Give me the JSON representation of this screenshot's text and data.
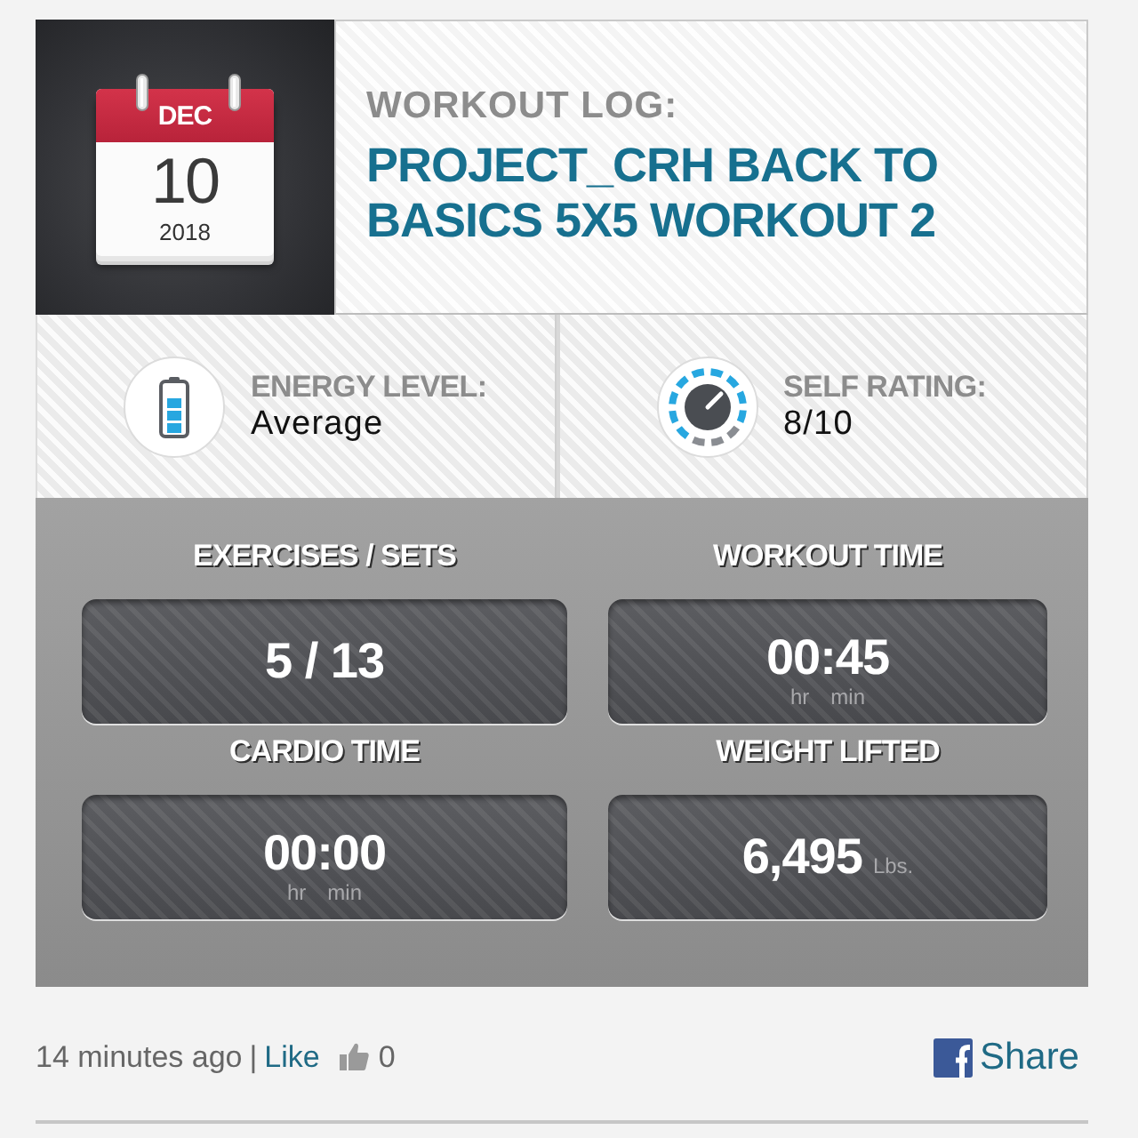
{
  "log": {
    "date": {
      "month": "DEC",
      "day": "10",
      "year": "2018"
    },
    "heading": "WORKOUT LOG:",
    "title": "PROJECT_CRH BACK TO BASICS 5X5 WORKOUT 2"
  },
  "ratings": [
    {
      "kind": "energy",
      "label": "ENERGY LEVEL:",
      "value": "Average"
    },
    {
      "kind": "rating",
      "label": "SELF RATING:",
      "value": "8/10"
    }
  ],
  "stats": [
    {
      "kind": "count",
      "label": "EXERCISES / SETS",
      "value": "5 / 13"
    },
    {
      "kind": "time",
      "label": "WORKOUT TIME",
      "value": "00:45",
      "units": [
        "hr",
        "min"
      ]
    },
    {
      "kind": "time",
      "label": "CARDIO TIME",
      "value": "00:00",
      "units": [
        "hr",
        "min"
      ]
    },
    {
      "kind": "weight",
      "label": "WEIGHT LIFTED",
      "value": "6,495",
      "unit": "Lbs."
    }
  ],
  "footer": {
    "time": "14 minutes ago",
    "separator": "|",
    "like": "Like",
    "likes": "0",
    "share": "Share"
  }
}
